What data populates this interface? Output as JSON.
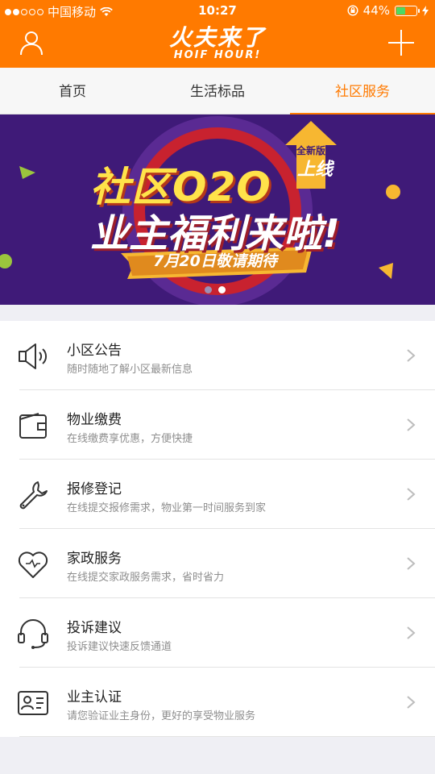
{
  "status_bar": {
    "carrier": "中国移动",
    "time": "10:27",
    "battery": "44%",
    "battery_level": 0.44
  },
  "header": {
    "logo_cn": "火夫来了",
    "logo_en": "HOIF HOUR!",
    "user_icon": "user-icon",
    "add_icon": "plus-icon",
    "accent_color": "#ff7a00"
  },
  "tabs": [
    {
      "label": "首页",
      "active": false
    },
    {
      "label": "生活标品",
      "active": false
    },
    {
      "label": "社区服务",
      "active": true
    }
  ],
  "banner": {
    "line1": "社区O2O",
    "line2": "业主福利来啦!",
    "ribbon": "7月20日敬请期待",
    "badge_top": "全新版本",
    "badge": "上线",
    "page_count": 2,
    "current_page": 2
  },
  "services": [
    {
      "icon": "speaker-icon",
      "title": "小区公告",
      "subtitle": "随时随地了解小区最新信息"
    },
    {
      "icon": "wallet-icon",
      "title": "物业缴费",
      "subtitle": "在线缴费享优惠，方便快捷"
    },
    {
      "icon": "wrench-icon",
      "title": "报修登记",
      "subtitle": "在线提交报修需求，物业第一时间服务到家"
    },
    {
      "icon": "heart-icon",
      "title": "家政服务",
      "subtitle": "在线提交家政服务需求，省时省力"
    },
    {
      "icon": "headset-icon",
      "title": "投诉建议",
      "subtitle": "投诉建议快速反馈通道"
    },
    {
      "icon": "id-card-icon",
      "title": "业主认证",
      "subtitle": "请您验证业主身份，更好的享受物业服务"
    }
  ]
}
